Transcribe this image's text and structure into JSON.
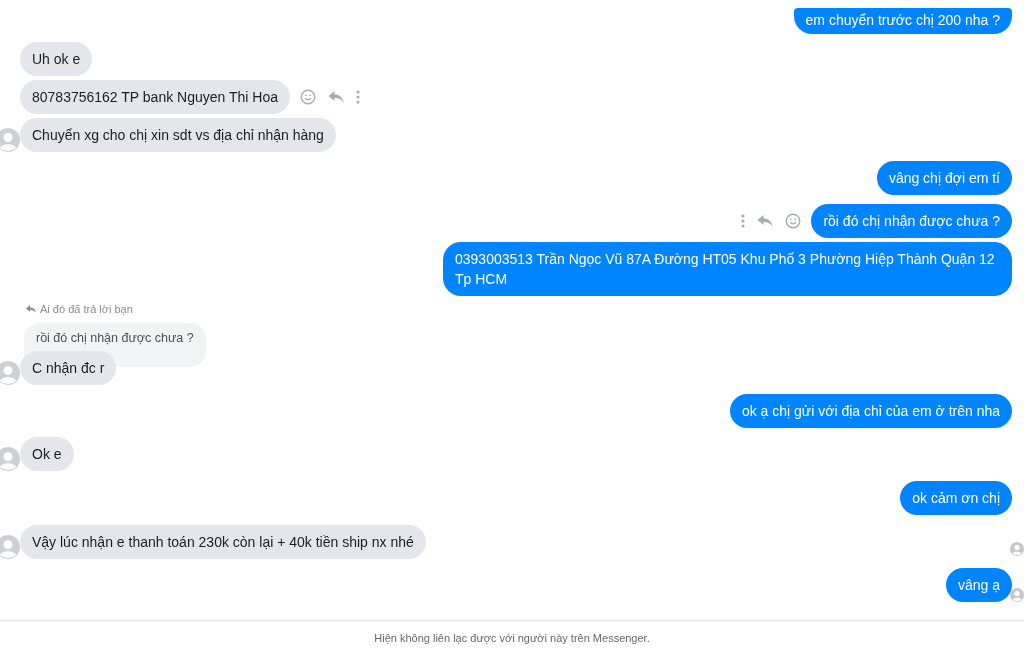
{
  "messages": [
    {
      "kind": "outgoing",
      "text": "em chuyển trước chị 200 nha ?",
      "show_actions": false,
      "seen": false
    },
    {
      "kind": "incoming",
      "text": "Uh ok e",
      "show_actions": false,
      "avatar": false
    },
    {
      "kind": "incoming",
      "text": "80783756162 TP bank Nguyen Thi Hoa",
      "show_actions": true,
      "avatar": false
    },
    {
      "kind": "incoming",
      "text": "Chuyển xg cho chị xin sdt vs địa chỉ nhận hàng",
      "show_actions": false,
      "avatar": true
    },
    {
      "kind": "outgoing",
      "text": "vâng chị đợi em tí",
      "show_actions": false,
      "seen": false
    },
    {
      "kind": "outgoing",
      "text": "rồi đó chị nhận được chưa ?",
      "show_actions": true,
      "seen": false
    },
    {
      "kind": "outgoing",
      "text": "0393003513 Trần Ngọc Vũ 87A Đường HT05 Khu Phố 3 Phường Hiệp Thành Quận 12 Tp HCM",
      "show_actions": false,
      "seen": false
    },
    {
      "kind": "incoming",
      "text": "C nhận đc r",
      "show_actions": false,
      "avatar": true,
      "reply": {
        "label": "Ai đó đã trả lời bạn",
        "quote": "rồi đó chị nhận được chưa ?"
      }
    },
    {
      "kind": "outgoing",
      "text": "ok ạ chị gửi với địa chỉ của em ở trên nha",
      "show_actions": false,
      "seen": false
    },
    {
      "kind": "incoming",
      "text": "Ok e",
      "show_actions": false,
      "avatar": true
    },
    {
      "kind": "outgoing",
      "text": "ok cảm ơn chị",
      "show_actions": false,
      "seen": false
    },
    {
      "kind": "incoming",
      "text": "Vậy lúc nhận e thanh toán 230k còn lại + 40k tiền ship nx nhé",
      "show_actions": false,
      "avatar": true
    },
    {
      "kind": "outgoing",
      "text": "vâng ạ",
      "show_actions": false,
      "seen": true
    }
  ],
  "footer": {
    "notice": "Hiện không liên lạc được với người này trên Messenger."
  }
}
